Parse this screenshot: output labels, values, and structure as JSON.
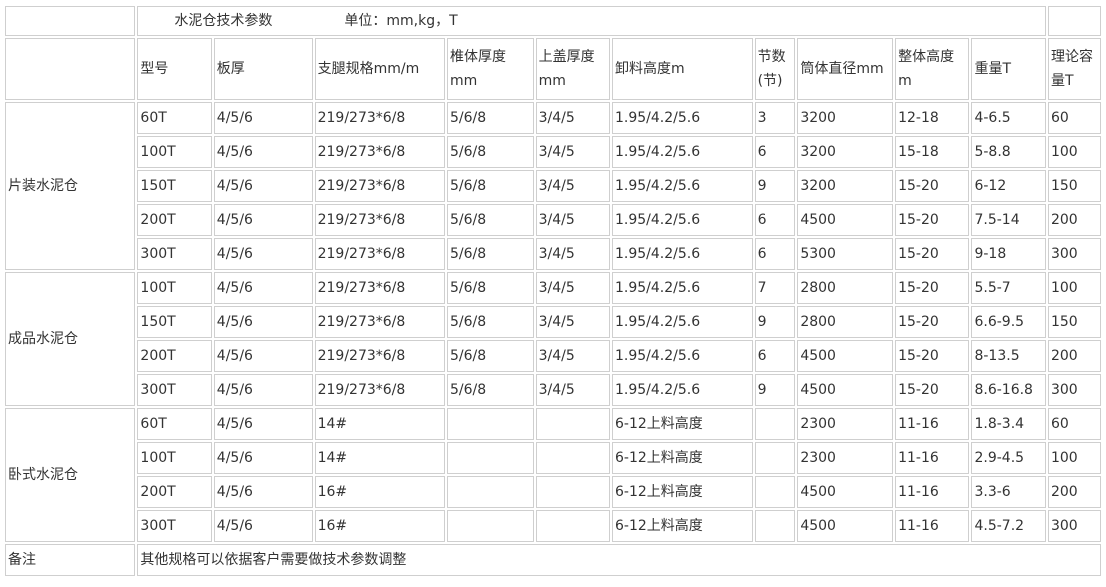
{
  "table": {
    "title": "水泥仓技术参数",
    "unit": "单位：mm,kg，T",
    "headers": [
      "型号",
      "板厚",
      "支腿规格mm/m",
      "椎体厚度mm",
      "上盖厚度mm",
      "卸料高度m",
      "节数(节)",
      "筒体直径mm",
      "整体高度m",
      "重量T",
      "理论容量T"
    ],
    "groups": [
      {
        "label": "片装水泥仓",
        "rows": [
          [
            "60T",
            "4/5/6",
            "219/273*6/8",
            "5/6/8",
            "3/4/5",
            "1.95/4.2/5.6",
            "3",
            "3200",
            "12-18",
            "4-6.5",
            "60"
          ],
          [
            "100T",
            "4/5/6",
            "219/273*6/8",
            "5/6/8",
            "3/4/5",
            "1.95/4.2/5.6",
            "6",
            "3200",
            "15-18",
            "5-8.8",
            "100"
          ],
          [
            "150T",
            "4/5/6",
            "219/273*6/8",
            "5/6/8",
            "3/4/5",
            "1.95/4.2/5.6",
            "9",
            "3200",
            "15-20",
            "6-12",
            "150"
          ],
          [
            "200T",
            "4/5/6",
            "219/273*6/8",
            "5/6/8",
            "3/4/5",
            "1.95/4.2/5.6",
            "6",
            "4500",
            "15-20",
            "7.5-14",
            "200"
          ],
          [
            "300T",
            "4/5/6",
            "219/273*6/8",
            "5/6/8",
            "3/4/5",
            "1.95/4.2/5.6",
            "6",
            "5300",
            "15-20",
            "9-18",
            "300"
          ]
        ]
      },
      {
        "label": "成品水泥仓",
        "rows": [
          [
            "100T",
            "4/5/6",
            "219/273*6/8",
            "5/6/8",
            "3/4/5",
            "1.95/4.2/5.6",
            "7",
            "2800",
            "15-20",
            "5.5-7",
            "100"
          ],
          [
            "150T",
            "4/5/6",
            "219/273*6/8",
            "5/6/8",
            "3/4/5",
            "1.95/4.2/5.6",
            "9",
            "2800",
            "15-20",
            "6.6-9.5",
            "150"
          ],
          [
            "200T",
            "4/5/6",
            "219/273*6/8",
            "5/6/8",
            "3/4/5",
            "1.95/4.2/5.6",
            "6",
            "4500",
            "15-20",
            "8-13.5",
            "200"
          ],
          [
            "300T",
            "4/5/6",
            "219/273*6/8",
            "5/6/8",
            "3/4/5",
            "1.95/4.2/5.6",
            "9",
            "4500",
            "15-20",
            "8.6-16.8",
            "300"
          ]
        ]
      },
      {
        "label": "卧式水泥仓",
        "rows": [
          [
            "60T",
            "4/5/6",
            "14#",
            "",
            "",
            "6-12上料高度",
            "",
            "2300",
            "11-16",
            "1.8-3.4",
            "60"
          ],
          [
            "100T",
            "4/5/6",
            "14#",
            "",
            "",
            "6-12上料高度",
            "",
            "2300",
            "11-16",
            "2.9-4.5",
            "100"
          ],
          [
            "200T",
            "4/5/6",
            "16#",
            "",
            "",
            "6-12上料高度",
            "",
            "4500",
            "11-16",
            "3.3-6",
            "200"
          ],
          [
            "300T",
            "4/5/6",
            "16#",
            "",
            "",
            "6-12上料高度",
            "",
            "4500",
            "11-16",
            "4.5-7.2",
            "300"
          ]
        ]
      }
    ],
    "remark_label": "备注",
    "remark_text": "其他规格可以依据客户需要做技术参数调整"
  }
}
